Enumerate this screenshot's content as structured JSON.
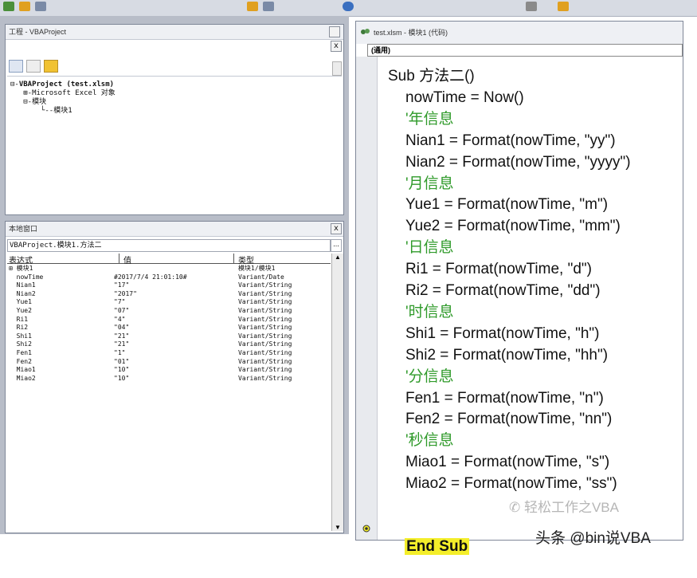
{
  "project_pane": {
    "title": "工程 - VBAProject",
    "close": "x",
    "tree": [
      {
        "prefix": "⊟-",
        "label": "VBAProject (test.xlsm)",
        "bold": true
      },
      {
        "prefix": "   ⊞-",
        "label": "Microsoft Excel 对象",
        "bold": false
      },
      {
        "prefix": "   ⊟-",
        "label": "模块",
        "bold": false
      },
      {
        "prefix": "       └--",
        "label": "模块1",
        "bold": false
      }
    ]
  },
  "locals_pane": {
    "title": "本地窗口",
    "close": "x",
    "context": "VBAProject.模块1.方法二",
    "context_btn": "...",
    "headers": {
      "expr": "表达式",
      "value": "值",
      "type": "类型"
    },
    "rows": [
      {
        "expr": "⊞ 模块1",
        "value": "",
        "type": "模块1/模块1"
      },
      {
        "expr": "  nowTime",
        "value": "#2017/7/4 21:01:10#",
        "type": "Variant/Date"
      },
      {
        "expr": "  Nian1",
        "value": "\"17\"",
        "type": "Variant/String"
      },
      {
        "expr": "  Nian2",
        "value": "\"2017\"",
        "type": "Variant/String"
      },
      {
        "expr": "  Yue1",
        "value": "\"7\"",
        "type": "Variant/String"
      },
      {
        "expr": "  Yue2",
        "value": "\"07\"",
        "type": "Variant/String"
      },
      {
        "expr": "  Ri1",
        "value": "\"4\"",
        "type": "Variant/String"
      },
      {
        "expr": "  Ri2",
        "value": "\"04\"",
        "type": "Variant/String"
      },
      {
        "expr": "  Shi1",
        "value": "\"21\"",
        "type": "Variant/String"
      },
      {
        "expr": "  Shi2",
        "value": "\"21\"",
        "type": "Variant/String"
      },
      {
        "expr": "  Fen1",
        "value": "\"1\"",
        "type": "Variant/String"
      },
      {
        "expr": "  Fen2",
        "value": "\"01\"",
        "type": "Variant/String"
      },
      {
        "expr": "  Miao1",
        "value": "\"10\"",
        "type": "Variant/String"
      },
      {
        "expr": "  Miao2",
        "value": "\"10\"",
        "type": "Variant/String"
      }
    ]
  },
  "code_window": {
    "title": "test.xlsm - 模块1 (代码)",
    "combo": "(通用)",
    "lines": [
      {
        "text": "Sub 方法二()",
        "kind": "code",
        "indent": 0
      },
      {
        "text": "nowTime = Now()",
        "kind": "code",
        "indent": 1
      },
      {
        "text": "'年信息",
        "kind": "comment",
        "indent": 1
      },
      {
        "text": "Nian1 = Format(nowTime, \"yy\")",
        "kind": "code",
        "indent": 1
      },
      {
        "text": "Nian2 = Format(nowTime, \"yyyy\")",
        "kind": "code",
        "indent": 1
      },
      {
        "text": "'月信息",
        "kind": "comment",
        "indent": 1
      },
      {
        "text": "Yue1 = Format(nowTime, \"m\")",
        "kind": "code",
        "indent": 1
      },
      {
        "text": "Yue2 = Format(nowTime, \"mm\")",
        "kind": "code",
        "indent": 1
      },
      {
        "text": "'日信息",
        "kind": "comment",
        "indent": 1
      },
      {
        "text": "Ri1 = Format(nowTime, \"d\")",
        "kind": "code",
        "indent": 1
      },
      {
        "text": "Ri2 = Format(nowTime, \"dd\")",
        "kind": "code",
        "indent": 1
      },
      {
        "text": "'时信息",
        "kind": "comment",
        "indent": 1
      },
      {
        "text": "Shi1 = Format(nowTime, \"h\")",
        "kind": "code",
        "indent": 1
      },
      {
        "text": "Shi2 = Format(nowTime, \"hh\")",
        "kind": "code",
        "indent": 1
      },
      {
        "text": "'分信息",
        "kind": "comment",
        "indent": 1
      },
      {
        "text": "Fen1 = Format(nowTime, \"n\")",
        "kind": "code",
        "indent": 1
      },
      {
        "text": "Fen2 = Format(nowTime, \"nn\")",
        "kind": "code",
        "indent": 1
      },
      {
        "text": "'秒信息",
        "kind": "comment",
        "indent": 1
      },
      {
        "text": "Miao1 = Format(nowTime, \"s\")",
        "kind": "code",
        "indent": 1
      },
      {
        "text": "Miao2 = Format(nowTime, \"ss\")",
        "kind": "code",
        "indent": 1
      }
    ],
    "end_line": "End Sub"
  },
  "watermarks": {
    "inner": "轻松工作之VBA",
    "outer": "头条 @bin说VBA"
  },
  "colors": {
    "comment": "#2f9a2a",
    "highlight": "#f4ee2a",
    "pane_border": "#7f8798"
  }
}
